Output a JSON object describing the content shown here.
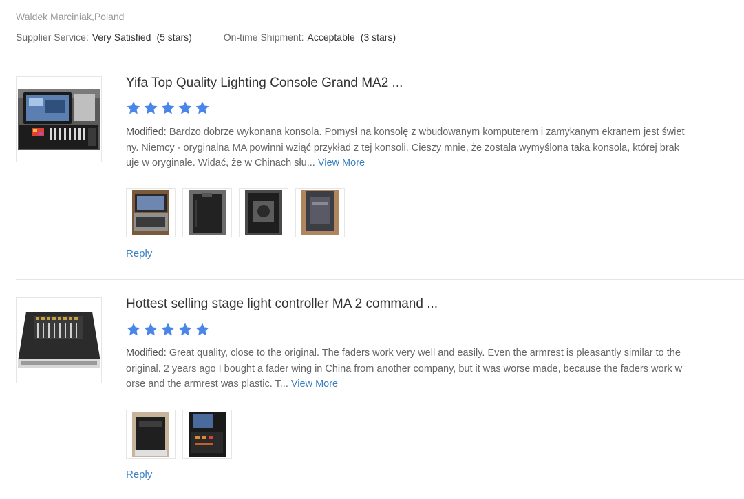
{
  "reviewer": {
    "name_location": "Waldek Marciniak,Poland"
  },
  "ratings": {
    "supplier_service": {
      "label": "Supplier Service:",
      "value": "Very Satisfied",
      "stars_text": "(5 stars)"
    },
    "ontime_shipment": {
      "label": "On-time Shipment:",
      "value": "Acceptable",
      "stars_text": "(3 stars)"
    }
  },
  "colors": {
    "star": "#4a86e8",
    "link": "#3a7fc2",
    "divider": "#e6e6e6"
  },
  "reviews": [
    {
      "product_title": "Yifa Top Quality Lighting Console Grand MA2 ...",
      "star_count": 5,
      "modified_label": "Modified:",
      "text": "Bardzo dobrze wykonana konsola. Pomysł na konsolę z wbudowanym komputerem i zamykanym ekranem jest świetny. Niemcy - oryginalna MA powinni wziąć przykład z tej konsoli. Cieszy mnie, że została wymyślona taka konsola, której brakuje w oryginale. Widać, że w Chinach słu...",
      "view_more": "View More",
      "photo_count": 4,
      "reply": "Reply"
    },
    {
      "product_title": "Hottest selling stage light controller MA 2 command ...",
      "star_count": 5,
      "modified_label": "Modified:",
      "text": "Great quality, close to the original. The faders work very well and easily. Even the armrest is pleasantly similar to the original. 2 years ago I bought a fader wing in China from another company, but it was worse made, because the faders work worse and the armrest was plastic. T...",
      "view_more": "View More",
      "photo_count": 2,
      "reply": "Reply"
    }
  ]
}
